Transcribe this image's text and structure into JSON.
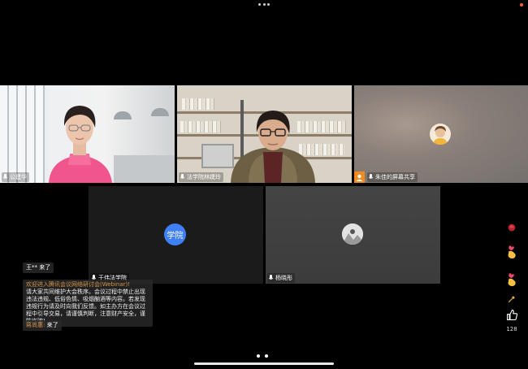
{
  "participants": [
    {
      "name": "公建华"
    },
    {
      "name": "法学院林婕玲"
    },
    {
      "name": "朱佳的屏幕共享"
    },
    {
      "name": "于伟法学院",
      "badge": "学院",
      "badge_color": "#3f80f6"
    },
    {
      "name": "杨晓彤"
    }
  ],
  "chat": {
    "join_msg_1": "王** 来了",
    "welcome_title": "欢迎进入腾讯会议网络研讨会(Webinar)!",
    "welcome_body": "请大家共同维护大会秩序。会议过程中禁止出现违法违规、低俗色情、吸烟酗酒等内容。若发现违规行为请及时向我们反馈。如主办方在会议过程中引导交易，请谨慎判断，注意财产安全，谨防诈骗!",
    "join_user_2": "蒋尚惠:",
    "join_text_2": "来了"
  },
  "reactions": {
    "like_count": "128",
    "items": [
      "rose-icon",
      "finger-heart-icon",
      "finger-heart-icon",
      "firework-icon",
      "thumbs-up-icon"
    ]
  },
  "colors": {
    "share_accent": "#f08b21",
    "chat_username": "#d4954b",
    "page_dot_active": "#ffffff",
    "page_dot_inactive": "#8a8a8a"
  }
}
